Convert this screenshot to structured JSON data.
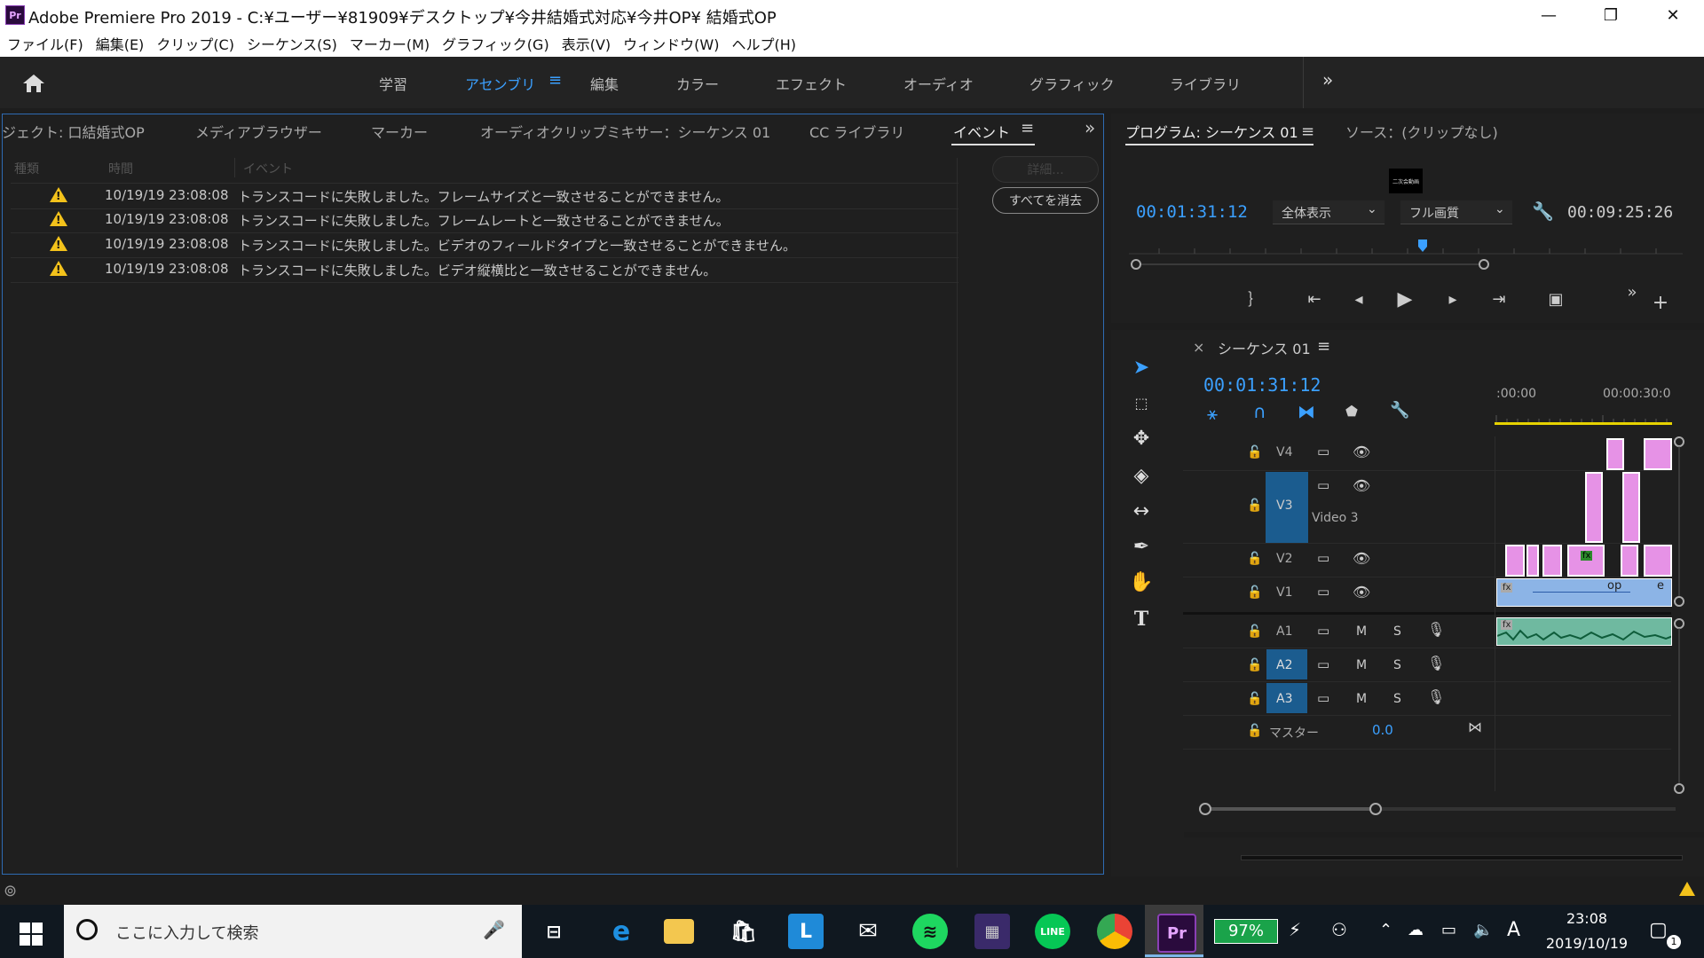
{
  "window": {
    "app_icon": "Pr",
    "title": "Adobe Premiere Pro 2019 - C:¥ユーザー¥81909¥デスクトップ¥今井結婚式対応¥今井OP¥ 結婚式OP"
  },
  "menu": [
    "ファイル(F)",
    "編集(E)",
    "クリップ(C)",
    "シーケンス(S)",
    "マーカー(M)",
    "グラフィック(G)",
    "表示(V)",
    "ウィンドウ(W)",
    "ヘルプ(H)"
  ],
  "workspaces": [
    "学習",
    "アセンブリ",
    "編集",
    "カラー",
    "エフェクト",
    "オーディオ",
    "グラフィック",
    "ライブラリ"
  ],
  "workspaces_active": "アセンブリ",
  "left_panel": {
    "tabs": [
      "ジェクト: 口結婚式OP",
      "メディアブラウザー",
      "マーカー",
      "オーディオクリップミキサー：シーケンス 01",
      "CC ライブラリ",
      "イベント"
    ],
    "active_tab": "イベント",
    "columns": [
      "種類",
      "時間",
      "イベント"
    ],
    "details_button": "詳細...",
    "clear_all_button": "すべてを消去",
    "events": [
      {
        "time": "10/19/19 23:08:08",
        "message": "トランスコードに失敗しました。フレームサイズと一致させることができません。"
      },
      {
        "time": "10/19/19 23:08:08",
        "message": "トランスコードに失敗しました。フレームレートと一致させることができません。"
      },
      {
        "time": "10/19/19 23:08:08",
        "message": "トランスコードに失敗しました。ビデオのフィールドタイプと一致させることができません。"
      },
      {
        "time": "10/19/19 23:08:08",
        "message": "トランスコードに失敗しました。ビデオ縦横比と一致させることができません。"
      }
    ]
  },
  "program_monitor": {
    "tab": "プログラム: シーケンス 01",
    "source_tab": "ソース：(クリップなし)",
    "timecode": "00:01:31:12",
    "zoom": "全体表示",
    "quality": "フル画質",
    "duration": "00:09:25:26",
    "thumbnail_text": "二次会動画"
  },
  "timeline": {
    "sequence_tab": "シーケンス 01",
    "close": "×",
    "timecode": "00:01:31:12",
    "ruler_labels": [
      ":00:00",
      "00:00:30:0"
    ],
    "video_tracks": [
      {
        "name": "V4",
        "label": ""
      },
      {
        "name": "V3",
        "label": "Video 3"
      },
      {
        "name": "V2",
        "label": ""
      },
      {
        "name": "V1",
        "label": ""
      }
    ],
    "audio_tracks": [
      "A1",
      "A2",
      "A3"
    ],
    "mute": "M",
    "solo": "S",
    "master_label": "マスター",
    "master_value": "0.0",
    "clip_fx": "fx",
    "clip_v1_name": "op",
    "clip_v1_suffix": "e"
  },
  "taskbar": {
    "search_placeholder": "ここに入力して検索",
    "battery": "97%",
    "time": "23:08",
    "date": "2019/10/19",
    "ime": "A",
    "notification_count": "1"
  },
  "colors": {
    "accent": "#3ba0ff",
    "track_selected": "#1b5c8f",
    "clip_pink": "#e692e6",
    "warning": "#f3c21b",
    "battery_green": "#1aa34a"
  }
}
